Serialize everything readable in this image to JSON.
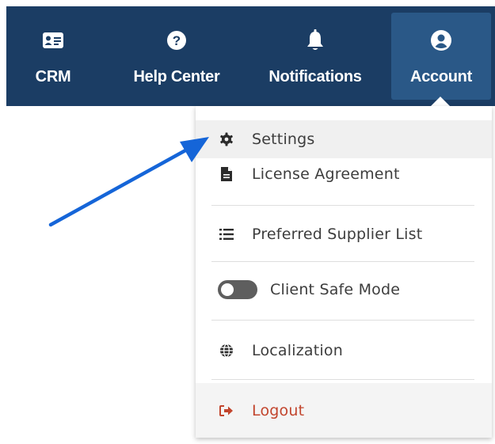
{
  "nav": {
    "items": [
      {
        "label": "CRM",
        "icon": "id-card-icon"
      },
      {
        "label": "Help Center",
        "icon": "question-circle-icon"
      },
      {
        "label": "Notifications",
        "icon": "bell-icon"
      },
      {
        "label": "Account",
        "icon": "user-circle-icon"
      }
    ],
    "colors": {
      "bar": "#1b3d64",
      "active": "#2a5887"
    }
  },
  "menu": {
    "items": [
      {
        "label": "Settings",
        "icon": "gear-icon"
      },
      {
        "label": "License Agreement",
        "icon": "file-icon"
      },
      {
        "label": "Preferred Supplier List",
        "icon": "list-icon"
      },
      {
        "label": "Client Safe Mode",
        "icon": "toggle-switch-icon",
        "toggle_state": "off"
      },
      {
        "label": "Localization",
        "icon": "globe-icon"
      },
      {
        "label": "Logout",
        "icon": "sign-out-icon"
      }
    ],
    "colors": {
      "logout": "#c2452d",
      "arrow": "#1565d8"
    }
  }
}
